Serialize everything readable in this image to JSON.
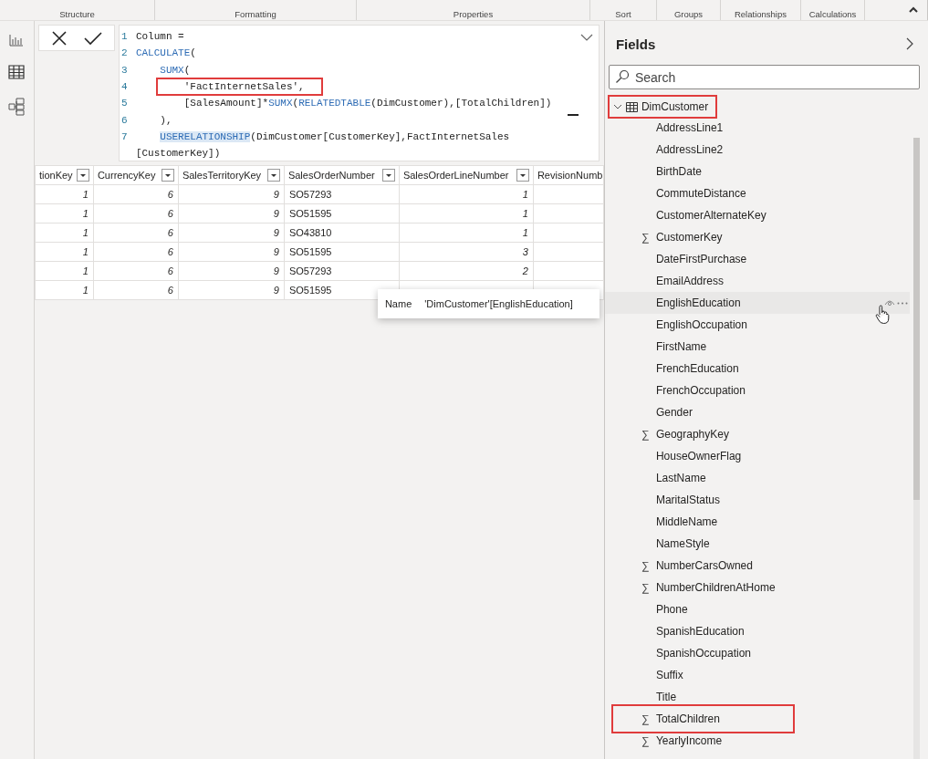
{
  "ribbon": {
    "groups": [
      {
        "label": "Structure"
      },
      {
        "label": "Formatting"
      },
      {
        "label": "Properties"
      },
      {
        "label": "Sort"
      },
      {
        "label": "Groups"
      },
      {
        "label": "Relationships"
      },
      {
        "label": "Calculations"
      }
    ]
  },
  "formula_bar": {
    "lines": [
      {
        "number": "1",
        "segments": [
          {
            "text": "Column =",
            "kind": "plain",
            "highlighted": false,
            "matched": false
          }
        ]
      },
      {
        "number": "2",
        "segments": [
          {
            "text": "CALCULATE",
            "kind": "function",
            "highlighted": false,
            "matched": false
          },
          {
            "text": "(",
            "kind": "plain",
            "highlighted": false,
            "matched": false
          }
        ]
      },
      {
        "number": "3",
        "kind": "nested",
        "segments": [
          {
            "text": "SUMX",
            "kind": "function",
            "highlighted": false,
            "matched": false
          },
          {
            "text": "(",
            "kind": "plain",
            "highlighted": false,
            "matched": false
          }
        ]
      },
      {
        "number": "4",
        "kind": "nested",
        "segments": [
          {
            "text": "    'FactInternetSales',",
            "kind": "plain",
            "highlighted": true,
            "matched": false
          }
        ]
      },
      {
        "number": "5",
        "kind": "deep",
        "segments": [
          {
            "text": "[SalesAmount]*",
            "kind": "plain",
            "highlighted": false,
            "matched": false
          },
          {
            "text": "SUMX",
            "kind": "function",
            "highlighted": false,
            "matched": false
          },
          {
            "text": "(",
            "kind": "plain",
            "highlighted": false,
            "matched": false
          },
          {
            "text": "RELATEDTABLE",
            "kind": "function",
            "highlighted": false,
            "matched": false
          },
          {
            "text": "(DimCustomer),[TotalChildren])",
            "kind": "plain",
            "highlighted": false,
            "matched": false
          }
        ]
      },
      {
        "number": "6",
        "kind": "nested",
        "segments": [
          {
            "text": "),",
            "kind": "plain",
            "highlighted": false,
            "matched": false
          }
        ]
      },
      {
        "number": "7",
        "kind": "nested",
        "segments": [
          {
            "text": "USERELATIONSHIP",
            "kind": "function",
            "highlighted": false,
            "matched": true
          },
          {
            "text": "(DimCustomer[CustomerKey],FactInternetSales",
            "kind": "plain",
            "highlighted": false,
            "matched": false
          }
        ]
      },
      {
        "segments": [
          {
            "text": "[CustomerKey])",
            "kind": "plain",
            "highlighted": false,
            "matched": false
          }
        ]
      }
    ]
  },
  "table": {
    "columns": [
      {
        "label": "tionKey",
        "kind": "number"
      },
      {
        "label": "CurrencyKey",
        "kind": "number"
      },
      {
        "label": "SalesTerritoryKey",
        "kind": "number"
      },
      {
        "label": "SalesOrderNumber",
        "kind": "text"
      },
      {
        "label": "SalesOrderLineNumber",
        "kind": "number"
      },
      {
        "label": "RevisionNumb",
        "kind": "number"
      }
    ],
    "rows": [
      [
        "1",
        "6",
        "9",
        "SO57293",
        "1"
      ],
      [
        "1",
        "6",
        "9",
        "SO51595",
        "1"
      ],
      [
        "1",
        "6",
        "9",
        "SO43810",
        "1"
      ],
      [
        "1",
        "6",
        "9",
        "SO51595",
        "3"
      ],
      [
        "1",
        "6",
        "9",
        "SO57293",
        "2"
      ],
      [
        "1",
        "6",
        "9",
        "SO51595"
      ]
    ]
  },
  "tooltip": {
    "label": "Name",
    "value": "'DimCustomer'[EnglishEducation]"
  },
  "fields": {
    "title": "Fields",
    "search": {
      "placeholder": "Search"
    },
    "tables": [
      {
        "name": "DimCustomer",
        "expanded": true,
        "highlighted": true,
        "children": [
          {
            "name": "AddressLine1",
            "hovered": false,
            "highlighted": false
          },
          {
            "name": "AddressLine2",
            "hovered": false,
            "highlighted": false
          },
          {
            "name": "BirthDate",
            "hovered": false,
            "highlighted": false
          },
          {
            "name": "CommuteDistance",
            "hovered": false,
            "highlighted": false
          },
          {
            "name": "CustomerAlternateKey",
            "hovered": false,
            "highlighted": false
          },
          {
            "name": "CustomerKey",
            "icon": "∑",
            "hovered": false,
            "highlighted": false
          },
          {
            "name": "DateFirstPurchase",
            "hovered": false,
            "highlighted": false
          },
          {
            "name": "EmailAddress",
            "hovered": false,
            "highlighted": false
          },
          {
            "name": "EnglishEducation",
            "hovered": true,
            "highlighted": false
          },
          {
            "name": "EnglishOccupation",
            "hovered": false,
            "highlighted": false
          },
          {
            "name": "FirstName",
            "hovered": false,
            "highlighted": false
          },
          {
            "name": "FrenchEducation",
            "hovered": false,
            "highlighted": false
          },
          {
            "name": "FrenchOccupation",
            "hovered": false,
            "highlighted": false
          },
          {
            "name": "Gender",
            "hovered": false,
            "highlighted": false
          },
          {
            "name": "GeographyKey",
            "icon": "∑",
            "hovered": false,
            "highlighted": false
          },
          {
            "name": "HouseOwnerFlag",
            "hovered": false,
            "highlighted": false
          },
          {
            "name": "LastName",
            "hovered": false,
            "highlighted": false
          },
          {
            "name": "MaritalStatus",
            "hovered": false,
            "highlighted": false
          },
          {
            "name": "MiddleName",
            "hovered": false,
            "highlighted": false
          },
          {
            "name": "NameStyle",
            "hovered": false,
            "highlighted": false
          },
          {
            "name": "NumberCarsOwned",
            "icon": "∑",
            "hovered": false,
            "highlighted": false
          },
          {
            "name": "NumberChildrenAtHome",
            "icon": "∑",
            "hovered": false,
            "highlighted": false
          },
          {
            "name": "Phone",
            "hovered": false,
            "highlighted": false
          },
          {
            "name": "SpanishEducation",
            "hovered": false,
            "highlighted": false
          },
          {
            "name": "SpanishOccupation",
            "hovered": false,
            "highlighted": false
          },
          {
            "name": "Suffix",
            "hovered": false,
            "highlighted": false
          },
          {
            "name": "Title",
            "hovered": false,
            "highlighted": false
          },
          {
            "name": "TotalChildren",
            "icon": "∑",
            "hovered": false,
            "highlighted": true
          },
          {
            "name": "YearlyIncome",
            "icon": "∑",
            "hovered": false,
            "highlighted": false
          }
        ]
      }
    ]
  }
}
